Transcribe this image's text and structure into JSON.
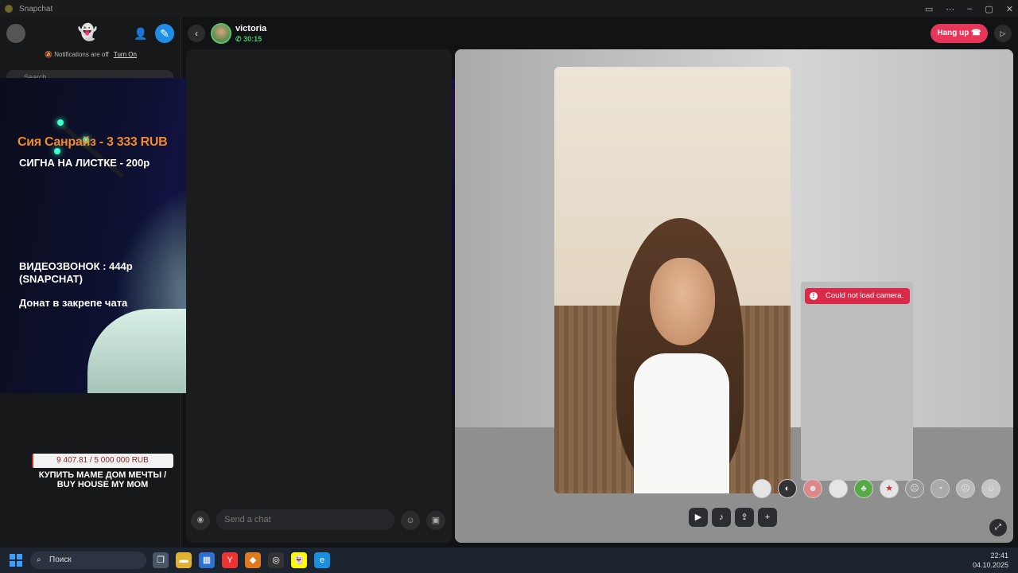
{
  "window": {
    "title": "Snapchat"
  },
  "sidebar": {
    "notifications_text": "Notifications are off",
    "turn_on_label": "Turn On",
    "search_placeholder": "Search"
  },
  "stream_overlay": {
    "donation_title": "Сия Санрайз - 3 333 RUB",
    "lines": [
      "СИГНА  НА ЛИСТКЕ - 200р",
      "ВИДЕОЗВОНОК  : 444р",
      "(SNAPCHAT)",
      "Донат в закрепе чата"
    ],
    "goal": {
      "text": "9 407.81 / 5 000 000 RUB",
      "progress": 0.0019,
      "caption_line1": "КУПИТЬ МАМЕ ДОМ МЕЧТЫ /",
      "caption_line2": "BUY HOUSE MY MOM"
    }
  },
  "chat_header": {
    "contact_name": "victoria",
    "call_time": "30:15",
    "hangup_label": "Hang up"
  },
  "chat": {
    "input_placeholder": "Send a chat"
  },
  "video": {
    "camera_error": "Could not load camera."
  },
  "taskbar": {
    "search_label": "Поиск",
    "time": "22:41",
    "date": "04.10.2025"
  },
  "colors": {
    "accent_blue": "#1e8fe8",
    "hangup_red": "#e8365a",
    "call_green": "#52c46e",
    "donation_orange": "#f28a2a"
  }
}
